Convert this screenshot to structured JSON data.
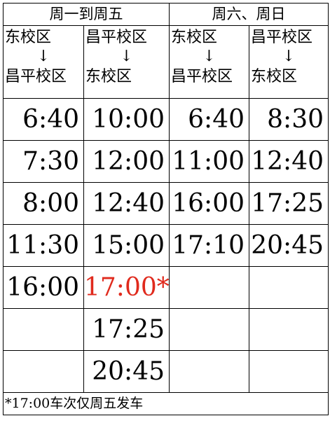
{
  "headers": {
    "weekday": "周一到周五",
    "weekend": "周六、周日"
  },
  "directions": [
    {
      "from": "东校区",
      "arrow": "↓",
      "to": "昌平校区"
    },
    {
      "from": "昌平校区",
      "arrow": "↓",
      "to": "东校区"
    },
    {
      "from": "东校区",
      "arrow": "↓",
      "to": "昌平校区"
    },
    {
      "from": "昌平校区",
      "arrow": "↓",
      "to": "东校区"
    }
  ],
  "rows": [
    [
      "6:40",
      "10:00",
      "6:40",
      "8:30"
    ],
    [
      "7:30",
      "12:00",
      "11:00",
      "12:40"
    ],
    [
      "8:00",
      "12:40",
      "16:00",
      "17:25"
    ],
    [
      "11:30",
      "15:00",
      "17:10",
      "20:45"
    ],
    [
      "16:00",
      "17:00*",
      "",
      ""
    ],
    [
      "",
      "17:25",
      "",
      ""
    ],
    [
      "",
      "20:45",
      "",
      ""
    ]
  ],
  "highlight_color": "#e02a1d",
  "footnote": "*17:00车次仅周五发车"
}
